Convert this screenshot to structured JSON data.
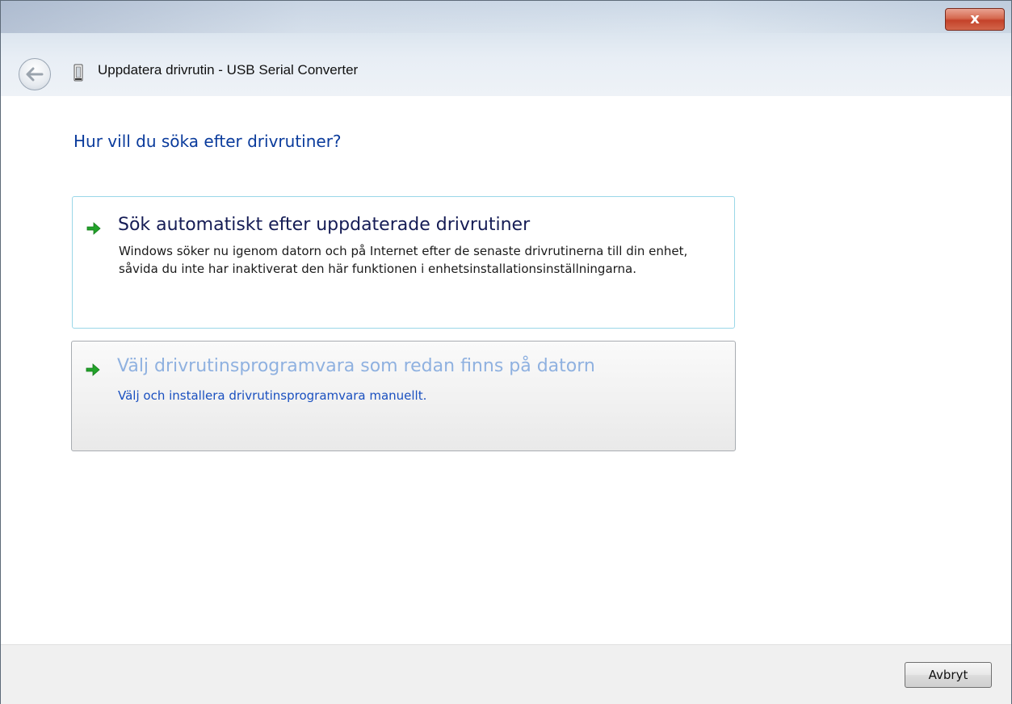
{
  "window": {
    "title": "Uppdatera drivrutin - USB Serial Converter",
    "close_label": "x"
  },
  "icons": {
    "back": "back-arrow-icon",
    "device": "usb-device-icon",
    "option_arrow": "green-arrow-icon"
  },
  "main": {
    "heading": "Hur vill du söka efter drivrutiner?",
    "options": [
      {
        "title": "Sök automatiskt efter uppdaterade drivrutiner",
        "description": "Windows söker nu igenom datorn och på Internet efter de senaste drivrutinerna till din enhet, såvida du inte har inaktiverat den här funktionen i enhetsinstallationsinställningarna."
      },
      {
        "title": "Välj drivrutinsprogramvara som redan finns på datorn",
        "description": "Välj och installera drivrutinsprogramvara manuellt."
      }
    ]
  },
  "footer": {
    "cancel_label": "Avbryt"
  },
  "colors": {
    "heading": "#0a3b9c",
    "option_hover_border": "#9ad7e8",
    "arrow_green": "#22a32a",
    "close_red": "#c4422a"
  }
}
